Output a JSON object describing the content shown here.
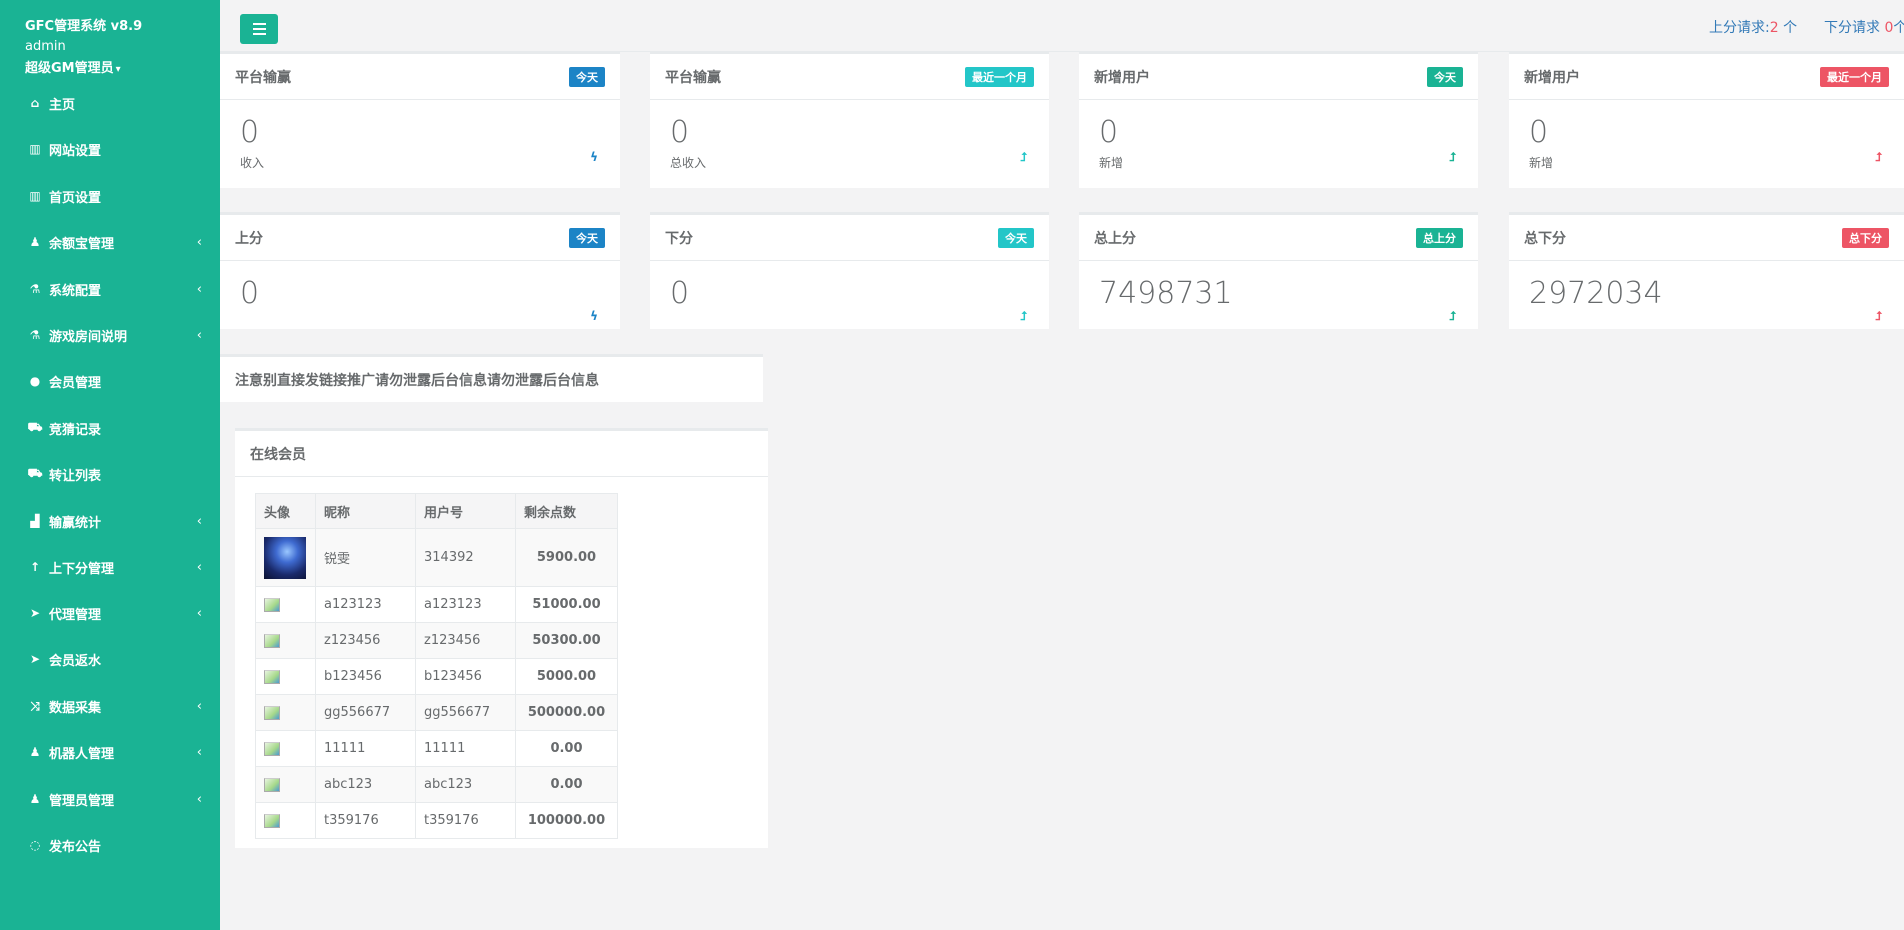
{
  "sidebar": {
    "brand": "GFC管理系统 v8.9",
    "user": "admin",
    "role": "超级GM管理员",
    "items": [
      {
        "label": "主页",
        "icon": "home-icon",
        "glyph": "⌂",
        "expandable": false
      },
      {
        "label": "网站设置",
        "icon": "columns-icon",
        "glyph": "▥",
        "expandable": false
      },
      {
        "label": "首页设置",
        "icon": "columns-icon",
        "glyph": "▥",
        "expandable": false
      },
      {
        "label": "余额宝管理",
        "icon": "male-icon",
        "glyph": "♟",
        "expandable": true
      },
      {
        "label": "系统配置",
        "icon": "flask-icon",
        "glyph": "⚗",
        "expandable": true
      },
      {
        "label": "游戏房间说明",
        "icon": "flask-icon",
        "glyph": "⚗",
        "expandable": true
      },
      {
        "label": "会员管理",
        "icon": "user-icon",
        "glyph": "●",
        "expandable": false
      },
      {
        "label": "竞猜记录",
        "icon": "cab-icon",
        "glyph": "⛟",
        "expandable": false
      },
      {
        "label": "转让列表",
        "icon": "cab-icon",
        "glyph": "⛟",
        "expandable": false
      },
      {
        "label": "输赢统计",
        "icon": "bar-chart-icon",
        "glyph": "▟",
        "expandable": true
      },
      {
        "label": "上下分管理",
        "icon": "level-up-icon",
        "glyph": "↑",
        "expandable": true
      },
      {
        "label": "代理管理",
        "icon": "paper-plane-icon",
        "glyph": "➤",
        "expandable": true
      },
      {
        "label": "会员返水",
        "icon": "paper-plane-icon",
        "glyph": "➤",
        "expandable": false
      },
      {
        "label": "数据采集",
        "icon": "random-icon",
        "glyph": "⤨",
        "expandable": true
      },
      {
        "label": "机器人管理",
        "icon": "male-icon",
        "glyph": "♟",
        "expandable": true
      },
      {
        "label": "管理员管理",
        "icon": "male-icon",
        "glyph": "♟",
        "expandable": true
      },
      {
        "label": "发布公告",
        "icon": "comment-icon",
        "glyph": "◌",
        "expandable": false
      }
    ]
  },
  "topbar": {
    "up_request_label": "上分请求:",
    "up_request_count": "2",
    "up_request_unit": " 个",
    "down_request_label": "下分请求 ",
    "down_request_count": "0",
    "down_request_unit": "个"
  },
  "cards": [
    {
      "title": "平台输赢",
      "badge": "今天",
      "badge_class": "lbl-blue",
      "value": "0",
      "sub": "收入",
      "icon": "bolt-icon",
      "icon_glyph": "ϟ",
      "icon_class": "ic-blue"
    },
    {
      "title": "平台输赢",
      "badge": "最近一个月",
      "badge_class": "lbl-cyan",
      "value": "0",
      "sub": "总收入",
      "icon": "level-up-icon",
      "icon_glyph": "⮥",
      "icon_class": "ic-cyan"
    },
    {
      "title": "新增用户",
      "badge": "今天",
      "badge_class": "lbl-green",
      "value": "0",
      "sub": "新增",
      "icon": "level-up-icon",
      "icon_glyph": "⮥",
      "icon_class": "ic-green"
    },
    {
      "title": "新增用户",
      "badge": "最近一个月",
      "badge_class": "lbl-red",
      "value": "0",
      "sub": "新增",
      "icon": "level-up-icon",
      "icon_glyph": "⮥",
      "icon_class": "ic-red"
    },
    {
      "title": "上分",
      "badge": "今天",
      "badge_class": "lbl-blue",
      "value": "0",
      "sub": "",
      "icon": "bolt-icon",
      "icon_glyph": "ϟ",
      "icon_class": "ic-blue"
    },
    {
      "title": "下分",
      "badge": "今天",
      "badge_class": "lbl-cyan",
      "value": "0",
      "sub": "",
      "icon": "level-up-icon",
      "icon_glyph": "⮥",
      "icon_class": "ic-cyan"
    },
    {
      "title": "总上分",
      "badge": "总上分",
      "badge_class": "lbl-green",
      "value": "7498731",
      "sub": "",
      "icon": "level-up-icon",
      "icon_glyph": "⮥",
      "icon_class": "ic-green"
    },
    {
      "title": "总下分",
      "badge": "总下分",
      "badge_class": "lbl-red",
      "value": "2972034",
      "sub": "",
      "icon": "level-up-icon",
      "icon_glyph": "⮥",
      "icon_class": "ic-red"
    }
  ],
  "notice": "注意别直接发链接推广请勿泄露后台信息请勿泄露后台信息",
  "online": {
    "title": "在线会员",
    "headers": [
      "头像",
      "昵称",
      "用户号",
      "剩余点数"
    ],
    "rows": [
      {
        "nickname": "锐雯",
        "uid": "314392",
        "points": "5900.00",
        "avatar": "avatar-image"
      },
      {
        "nickname": "a123123",
        "uid": "a123123",
        "points": "51000.00",
        "avatar": "broken-image-icon"
      },
      {
        "nickname": "z123456",
        "uid": "z123456",
        "points": "50300.00",
        "avatar": "broken-image-icon"
      },
      {
        "nickname": "b123456",
        "uid": "b123456",
        "points": "5000.00",
        "avatar": "broken-image-icon"
      },
      {
        "nickname": "gg556677",
        "uid": "gg556677",
        "points": "500000.00",
        "avatar": "broken-image-icon"
      },
      {
        "nickname": "11111",
        "uid": "11111",
        "points": "0.00",
        "avatar": "broken-image-icon"
      },
      {
        "nickname": "abc123",
        "uid": "abc123",
        "points": "0.00",
        "avatar": "broken-image-icon"
      },
      {
        "nickname": "t359176",
        "uid": "t359176",
        "points": "100000.00",
        "avatar": "broken-image-icon"
      }
    ]
  }
}
